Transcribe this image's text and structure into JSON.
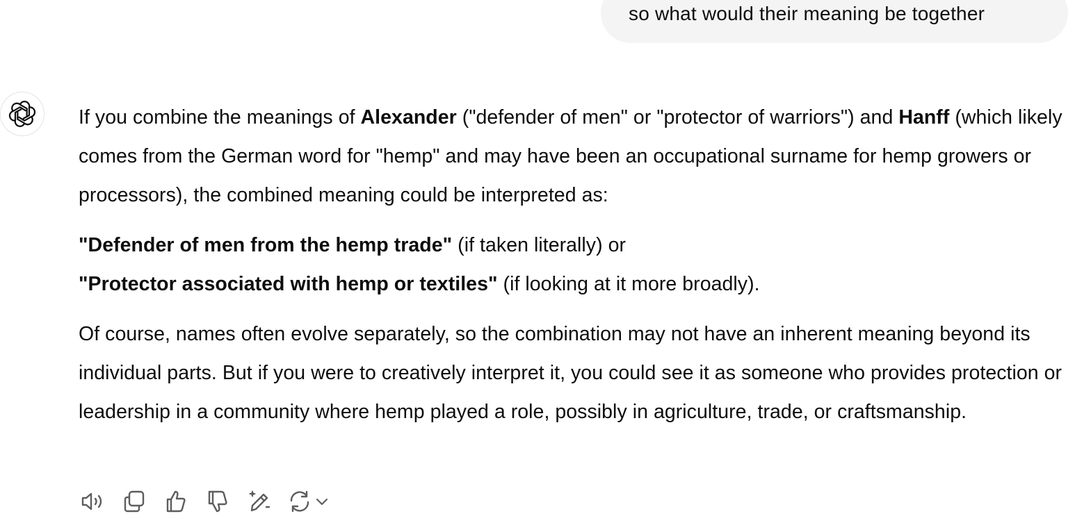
{
  "user_message": "so what would their meaning be together",
  "assistant": {
    "paragraph1": {
      "t1": "If you combine the meanings of ",
      "b1": "Alexander",
      "t2": " (\"defender of men\" or \"protector of warriors\") and ",
      "b2": "Hanff",
      "t3": " (which likely comes from the German word for \"hemp\" and may have been an occupational surname for hemp growers or processors), the combined meaning could be interpreted as:"
    },
    "paragraph2": {
      "b1": "\"Defender of men from the hemp trade\"",
      "t1": " (if taken literally) or",
      "b2": "\"Protector associated with hemp or textiles\"",
      "t2": " (if looking at it more broadly)."
    },
    "paragraph3": "Of course, names often evolve separately, so the combination may not have an inherent meaning beyond its individual parts. But if you were to creatively interpret it, you could see it as someone who provides protection or leadership in a community where hemp played a role, possibly in agriculture, trade, or craftsmanship."
  },
  "toolbar": {
    "icons": [
      "read-aloud-icon",
      "copy-icon",
      "thumbs-up-icon",
      "thumbs-down-icon",
      "edit-canvas-icon",
      "regenerate-icon",
      "chevron-down-icon"
    ]
  },
  "colors": {
    "user_bubble_bg": "#f4f4f4",
    "text": "#0d0d0d",
    "icon": "#5d5d5d"
  }
}
